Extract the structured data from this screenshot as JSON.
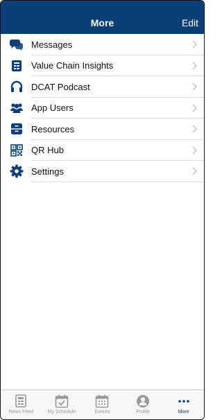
{
  "header": {
    "title": "More",
    "edit_label": "Edit"
  },
  "menu": [
    {
      "label": "Messages",
      "icon": "chat-bubbles-icon"
    },
    {
      "label": "Value Chain Insights",
      "icon": "report-icon"
    },
    {
      "label": "DCAT Podcast",
      "icon": "headphones-icon"
    },
    {
      "label": "App Users",
      "icon": "users-icon"
    },
    {
      "label": "Resources",
      "icon": "drawer-icon"
    },
    {
      "label": "QR Hub",
      "icon": "qr-code-icon"
    },
    {
      "label": "Settings",
      "icon": "gear-icon"
    }
  ],
  "tabbar": [
    {
      "label": "News Feed",
      "icon": "newspaper-icon"
    },
    {
      "label": "My Schedule",
      "icon": "calendar-check-icon"
    },
    {
      "label": "Events",
      "icon": "calendar-grid-icon"
    },
    {
      "label": "Profile",
      "icon": "person-icon"
    },
    {
      "label": "More",
      "icon": "ellipsis-icon",
      "active": true
    }
  ],
  "colors": {
    "brand": "#0b3f77",
    "inactive": "#9a9a9a",
    "separator": "#dcdcdc"
  }
}
